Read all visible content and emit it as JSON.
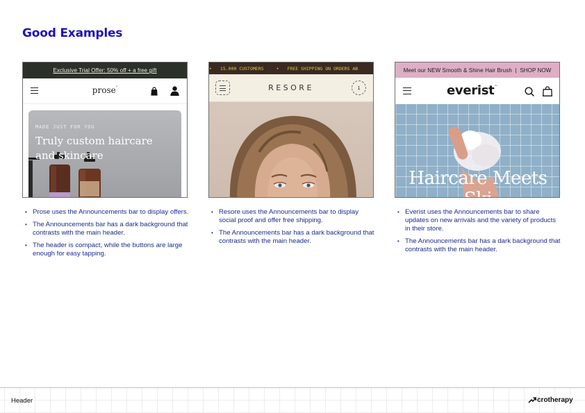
{
  "page": {
    "title": "Good Examples",
    "title_color": "#1f13b8"
  },
  "examples": [
    {
      "brand": "prose",
      "announcement": "Exclusive Trial Offer: 50% off + a free gift",
      "logo": "prose",
      "kicker": "MADE JUST FOR YOU",
      "headline": "Truly custom haircare and skincare",
      "icons": [
        "menu-icon",
        "shopping-bag-icon",
        "user-icon"
      ],
      "bullets": [
        "Prose uses the Announcements bar to display offers.",
        "The Announcements bar has a dark background that contrasts with the main header.",
        "The header is compact, while the buttons are large enough for easy tapping."
      ]
    },
    {
      "brand": "resore",
      "announcement_items": [
        "15.000 CUSTOMERS",
        "FREE SHIPPING ON ORDERS AB"
      ],
      "announcement_separator": "•",
      "logo": "RESORE",
      "cart_count": "1",
      "icons": [
        "menu-icon",
        "cart-icon"
      ],
      "bullets": [
        "Resore uses the Announcements bar to display social proof and offer free shipping.",
        "The Announcements bar has a dark background that contrasts with the main header."
      ]
    },
    {
      "brand": "everist",
      "announcement": "Meet our NEW Smooth & Shine Hair Brush  |  SHOP NOW",
      "logo": "everist",
      "logo_mark": "™",
      "headline": "Haircare Meets Ski",
      "icons": [
        "menu-icon",
        "search-icon",
        "shopping-bag-icon"
      ],
      "bullets": [
        "Everist uses the Announcements bar to share updates on new arrivals and the variety of products in their store.",
        "The Announcements bar has a dark background that contrasts with the main header."
      ]
    }
  ],
  "footer": {
    "label": "Header",
    "brand": "crotherapy",
    "brand_icon": "arrow-up-right-icon"
  },
  "colors": {
    "prose_announcement_bg": "#2b3128",
    "resore_announcement_bg": "#3a2a22",
    "resore_announcement_text": "#e8c34a",
    "everist_announcement_bg": "#deaec6",
    "bullet_text": "#1b2b8c"
  }
}
